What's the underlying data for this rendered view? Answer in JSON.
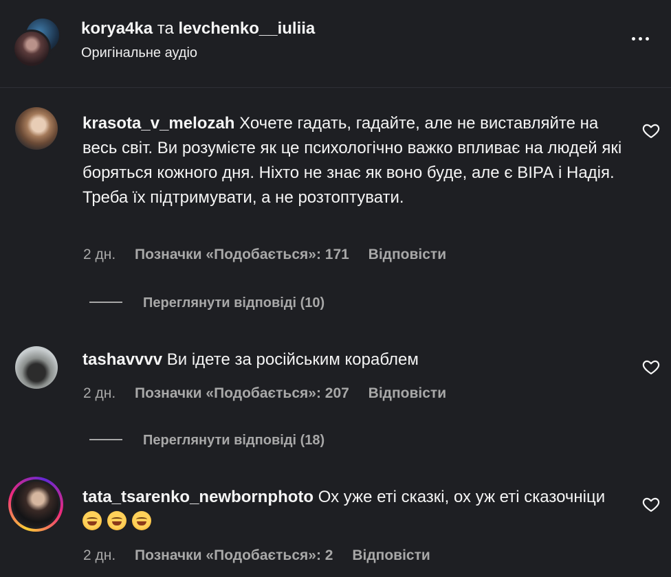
{
  "header": {
    "user1": "korya4ka",
    "connector": "та",
    "user2": "levchenko__iuliia",
    "audio": "Оригінальне аудіо"
  },
  "comments": [
    {
      "username": "krasota_v_melozah",
      "text": "Хочете гадать, гадайте, але не виставляйте на весь світ. Ви розумієте як це психологічно важко впливає на людей які боряться кожного дня. Ніхто не знає як воно буде, але є ВІРА і Надія. Треба їх підтримувати, а не розтоптувати.",
      "time": "2 дн.",
      "likes": "Позначки «Подобається»: 171",
      "reply": "Відповісти",
      "view_replies": "Переглянути відповіді (10)"
    },
    {
      "username": "tashavvvv",
      "text": "Ви ідете за російським кораблем",
      "time": "2 дн.",
      "likes": "Позначки «Подобається»: 207",
      "reply": "Відповісти",
      "view_replies": "Переглянути відповіді (18)"
    },
    {
      "username": "tata_tsarenko_newbornphoto",
      "text": "Ох уже еті сказкі, ох уж еті сказочніци",
      "time": "2 дн.",
      "likes": "Позначки «Подобається»: 2",
      "reply": "Відповісти",
      "emoji_count": 3,
      "emoji": "smiling-face-with-sweat"
    }
  ],
  "colors": {
    "background": "#1e1f23",
    "text": "#f5f5f5",
    "secondary_text": "#a8a8a8"
  }
}
